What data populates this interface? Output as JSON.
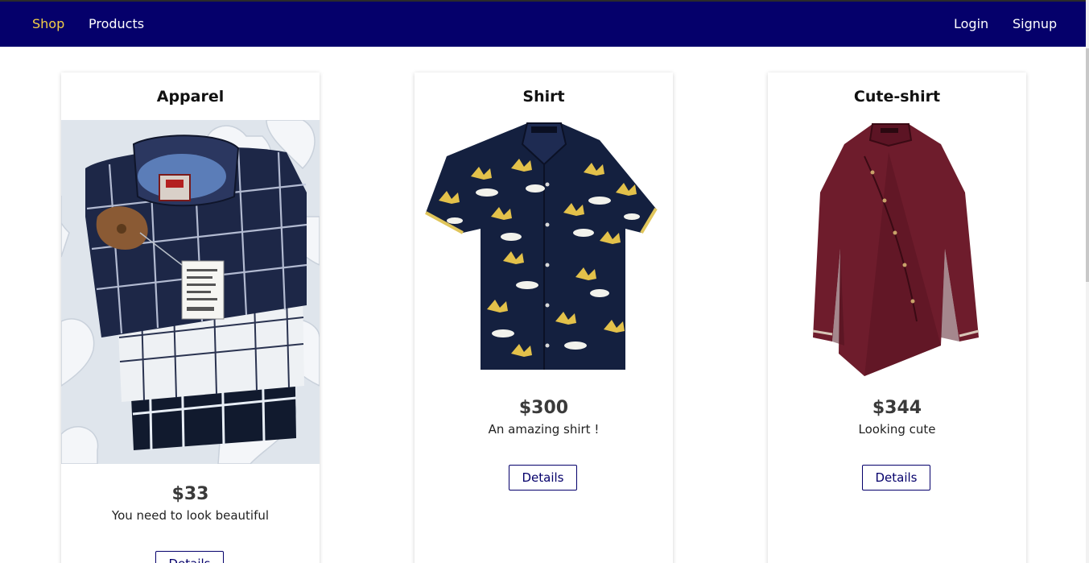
{
  "nav": {
    "brand": "Shop",
    "products": "Products",
    "login": "Login",
    "signup": "Signup"
  },
  "colors": {
    "nav_bg": "#05006b",
    "nav_active": "#f4cf47",
    "button_border": "#05006b"
  },
  "products": [
    {
      "title": "Apparel",
      "price": "$33",
      "description": "You need to look beautiful",
      "button": "Details",
      "image_icon": "stacked-plaid-shirts-image"
    },
    {
      "title": "Shirt",
      "price": "$300",
      "description": "An amazing shirt !",
      "button": "Details",
      "image_icon": "hawaiian-shirt-image"
    },
    {
      "title": "Cute-shirt",
      "price": "$344",
      "description": "Looking cute",
      "button": "Details",
      "image_icon": "maroon-shirt-image"
    }
  ]
}
